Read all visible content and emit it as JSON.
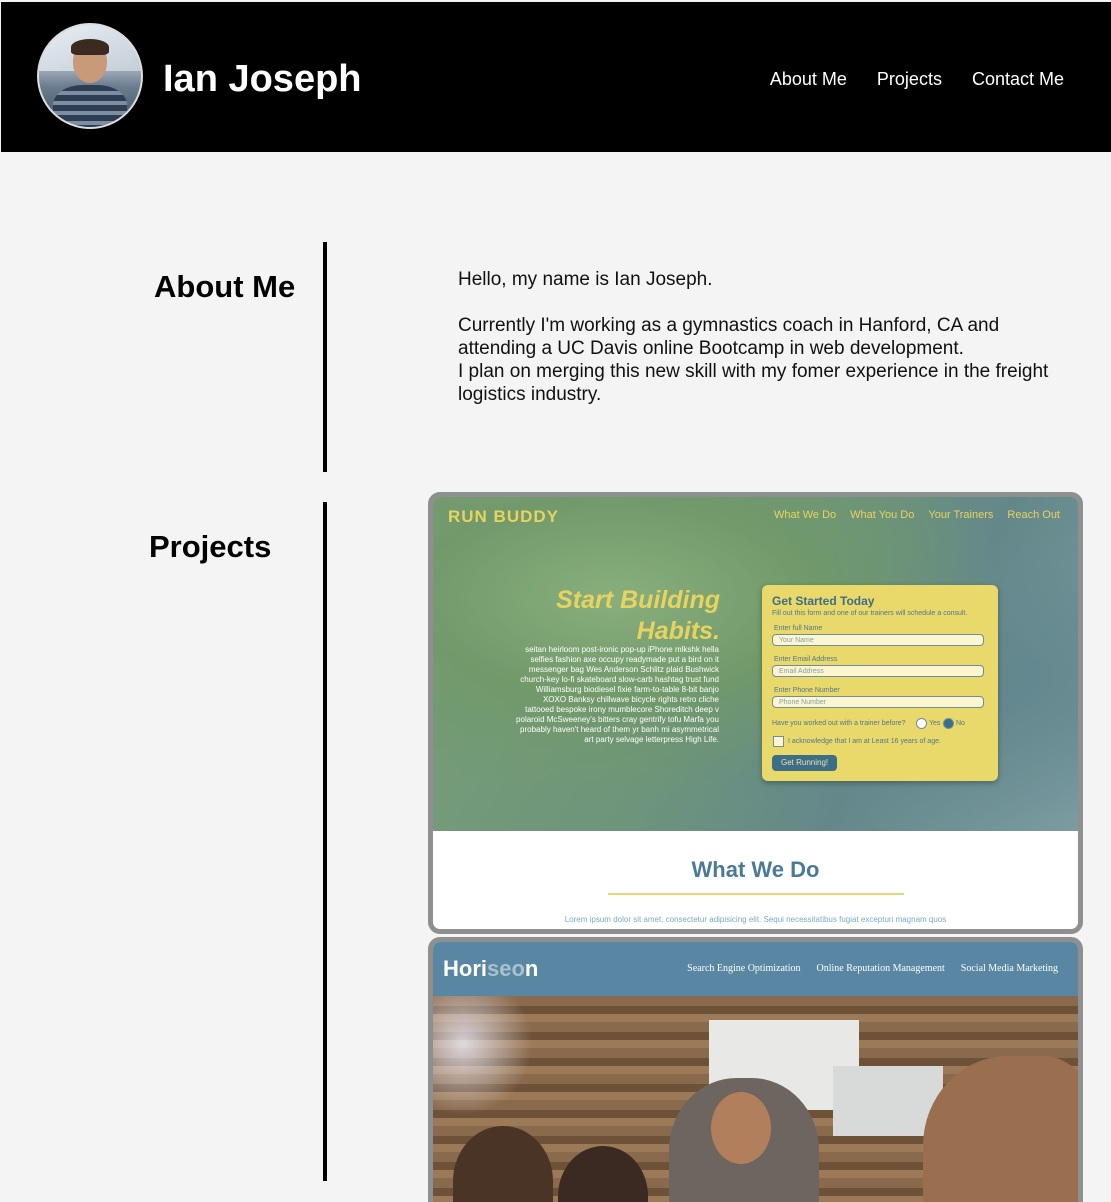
{
  "header": {
    "title": "Ian Joseph",
    "avatar_alt": "profile photo",
    "nav": [
      "About Me",
      "Projects",
      "Contact Me"
    ]
  },
  "about": {
    "heading": "About Me",
    "paragraphs": [
      "Hello, my name is Ian Joseph.",
      "Currently I'm working as a gymnastics coach in Hanford, CA and attending a UC Davis online Bootcamp in web development.",
      "I plan on merging this new skill with my fomer experience in the freight logistics industry."
    ]
  },
  "projects": {
    "heading": "Projects",
    "run_buddy": {
      "logo": "RUN BUDDY",
      "nav": [
        "What We Do",
        "What You Do",
        "Your Trainers",
        "Reach Out"
      ],
      "headline_1": "Start Building",
      "headline_2": "Habits.",
      "copy": "seitan heirloom post-ironic pop-up iPhone mlkshk hella selfies fashion axe occupy readymade put a bird on it messenger bag Wes Anderson Schlitz plaid Bushwick church-key lo-fi skateboard slow-carb hashtag trust fund Williamsburg biodiesel fixie farm-to-table 8-bit banjo XOXO Banksy chillwave bicycle rights retro cliche tattooed bespoke irony mumblecore Shoreditch deep v polaroid McSweeney's bitters cray gentrify tofu Marfa you probably haven't heard of them yr banh mi asymmetrical art party selvage letterpress High Life.",
      "form_title": "Get Started Today",
      "form_subtitle": "Fill out this form and one of our trainers will schedule a consult.",
      "name_label": "Enter full Name",
      "name_placeholder": "Your Name",
      "email_label": "Enter Email Address",
      "email_placeholder": "Email Address",
      "phone_label": "Enter Phone Number",
      "phone_placeholder": "Phone Number",
      "question": "Have you worked out with a trainer before?",
      "yes": "Yes",
      "no": "No",
      "ack": "I acknowledge that I am at Least 16 years of age.",
      "button": "Get Running!",
      "section_title": "What We Do",
      "lorem": "Lorem ipsum dolor sit amet, consectetur adipisicing elit. Sequi necessitatibus fugiat excepturi magnam quos"
    },
    "horiseon": {
      "logo_a": "Hori",
      "logo_b": "seo",
      "logo_c": "n",
      "nav": [
        "Search Engine Optimization",
        "Online Reputation Management",
        "Social Media Marketing"
      ]
    }
  },
  "colors": {
    "header_bg": "#000000",
    "page_bg": "#f4f4f4",
    "run_buddy_yellow": "#e8d360",
    "run_buddy_blue": "#3d6e88",
    "horiseon_blue": "#5886a3"
  }
}
